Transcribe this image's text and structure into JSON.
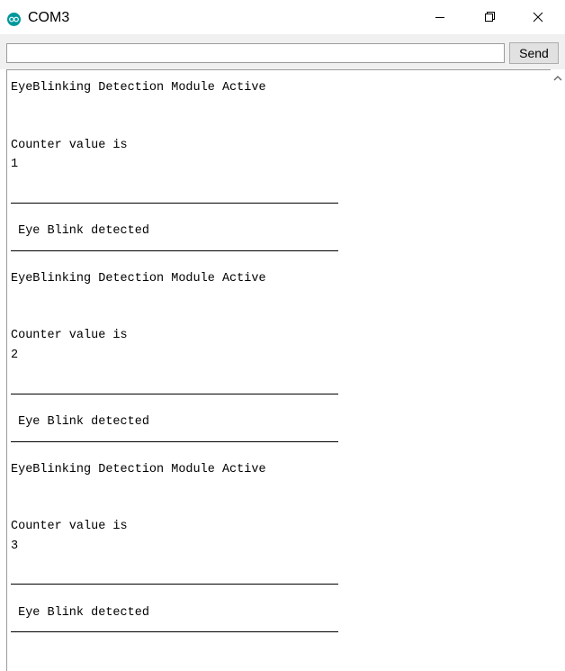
{
  "window": {
    "title": "COM3"
  },
  "toolbar": {
    "input_value": "",
    "send_label": "Send"
  },
  "output": {
    "lines": [
      "EyeBlinking Detection Module Active",
      "",
      "",
      "Counter value is",
      "1",
      "",
      "---",
      " Eye Blink detected",
      "---",
      "EyeBlinking Detection Module Active",
      "",
      "",
      "Counter value is",
      "2",
      "",
      "---",
      " Eye Blink detected",
      "---",
      "EyeBlinking Detection Module Active",
      "",
      "",
      "Counter value is",
      "3",
      "",
      "---",
      " Eye Blink detected",
      "---"
    ]
  },
  "icons": {
    "app": "arduino-icon",
    "minimize": "minimize-icon",
    "maximize": "maximize-icon",
    "close": "close-icon",
    "scroll_up": "chevron-up-icon"
  },
  "colors": {
    "app_icon": "#00979c",
    "toolbar_bg": "#f0f0f0",
    "button_bg": "#e1e1e1"
  }
}
